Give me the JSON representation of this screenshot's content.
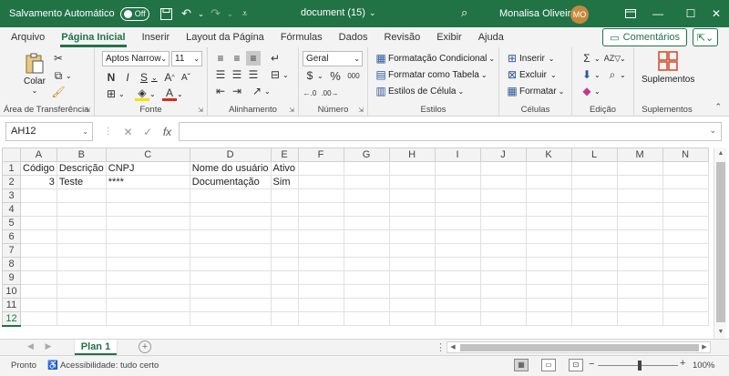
{
  "titlebar": {
    "autosave_label": "Salvamento Automático",
    "autosave_state": "Off",
    "doc_title": "document (15)",
    "doc_title_arrow": "⌄",
    "user_name": "Monalisa Oliveira",
    "user_initials": "MO"
  },
  "menu": {
    "items": [
      "Arquivo",
      "Página Inicial",
      "Inserir",
      "Layout da Página",
      "Fórmulas",
      "Dados",
      "Revisão",
      "Exibir",
      "Ajuda"
    ],
    "active": "Página Inicial",
    "comments_label": "Comentários"
  },
  "ribbon": {
    "clipboard": {
      "paste_label": "Colar",
      "group_label": "Área de Transferência"
    },
    "font": {
      "font_name": "Aptos Narrow",
      "font_size": "11",
      "group_label": "Fonte",
      "underline_color": "#d52b1e",
      "highlight_color": "#f5e000"
    },
    "alignment": {
      "group_label": "Alinhamento"
    },
    "number": {
      "format": "Geral",
      "group_label": "Número"
    },
    "styles": {
      "conditional": "Formatação Condicional",
      "as_table": "Formatar como Tabela",
      "cell_styles": "Estilos de Célula",
      "group_label": "Estilos"
    },
    "cells": {
      "insert": "Inserir",
      "delete": "Excluir",
      "format": "Formatar",
      "group_label": "Células"
    },
    "editing": {
      "group_label": "Edição"
    },
    "addins": {
      "label": "Suplementos",
      "group_label": "Suplementos"
    }
  },
  "formula_bar": {
    "name_box": "AH12",
    "formula": ""
  },
  "grid": {
    "columns": [
      "A",
      "B",
      "C",
      "D",
      "E",
      "F",
      "G",
      "H",
      "I",
      "J",
      "K",
      "L",
      "M",
      "N"
    ],
    "rows": [
      [
        "Código",
        "Descrição",
        "CNPJ",
        "Nome do usuário",
        "Ativo",
        "",
        "",
        "",
        "",
        "",
        "",
        "",
        "",
        ""
      ],
      [
        "3",
        "Teste",
        "****",
        "Documentação",
        "Sim",
        "",
        "",
        "",
        "",
        "",
        "",
        "",
        "",
        ""
      ],
      [
        "",
        "",
        "",
        "",
        "",
        "",
        "",
        "",
        "",
        "",
        "",
        "",
        "",
        ""
      ],
      [
        "",
        "",
        "",
        "",
        "",
        "",
        "",
        "",
        "",
        "",
        "",
        "",
        "",
        ""
      ],
      [
        "",
        "",
        "",
        "",
        "",
        "",
        "",
        "",
        "",
        "",
        "",
        "",
        "",
        ""
      ],
      [
        "",
        "",
        "",
        "",
        "",
        "",
        "",
        "",
        "",
        "",
        "",
        "",
        "",
        ""
      ],
      [
        "",
        "",
        "",
        "",
        "",
        "",
        "",
        "",
        "",
        "",
        "",
        "",
        "",
        ""
      ],
      [
        "",
        "",
        "",
        "",
        "",
        "",
        "",
        "",
        "",
        "",
        "",
        "",
        "",
        ""
      ],
      [
        "",
        "",
        "",
        "",
        "",
        "",
        "",
        "",
        "",
        "",
        "",
        "",
        "",
        ""
      ],
      [
        "",
        "",
        "",
        "",
        "",
        "",
        "",
        "",
        "",
        "",
        "",
        "",
        "",
        ""
      ],
      [
        "",
        "",
        "",
        "",
        "",
        "",
        "",
        "",
        "",
        "",
        "",
        "",
        "",
        ""
      ],
      [
        "",
        "",
        "",
        "",
        "",
        "",
        "",
        "",
        "",
        "",
        "",
        "",
        "",
        ""
      ]
    ],
    "numeric_cells": [
      "1-0"
    ]
  },
  "sheets": {
    "tabs": [
      "Plan 1"
    ],
    "active": "Plan 1"
  },
  "status": {
    "ready": "Pronto",
    "accessibility": "Acessibilidade: tudo certo",
    "zoom": "100%"
  },
  "colors": {
    "accent": "#217346"
  }
}
